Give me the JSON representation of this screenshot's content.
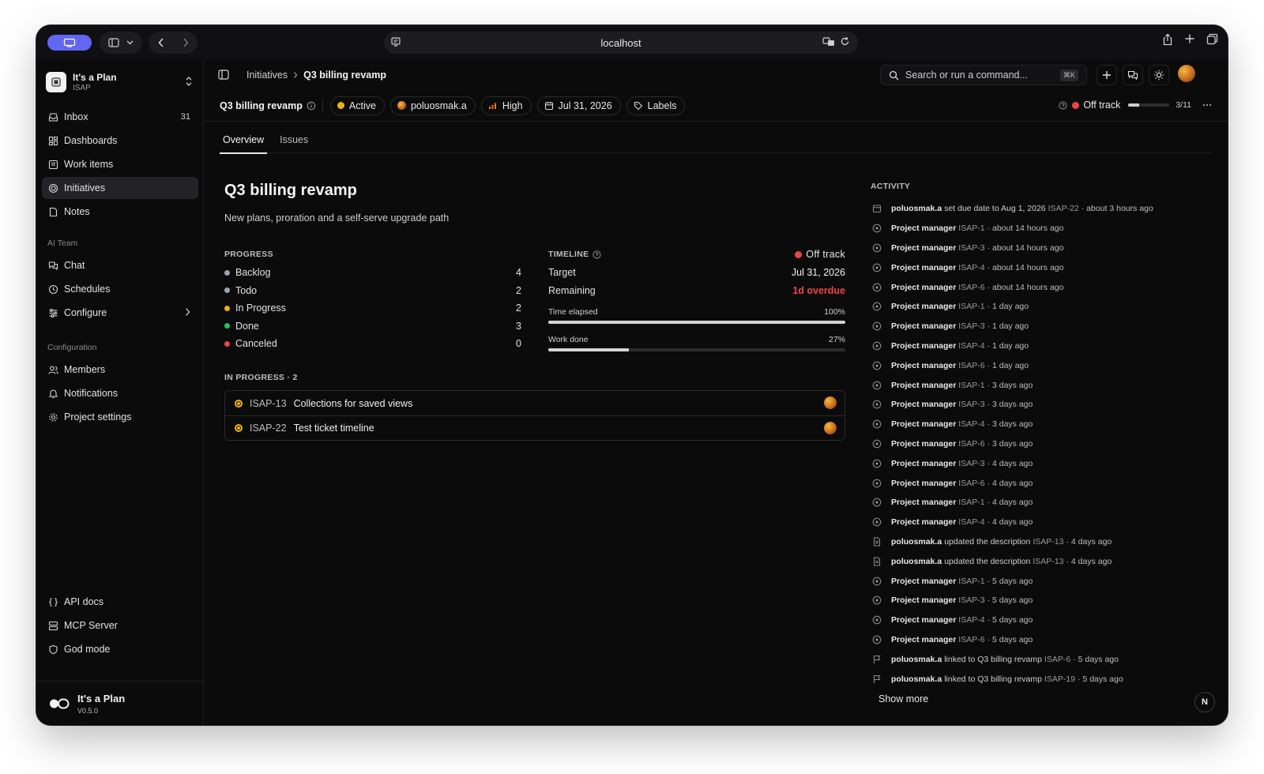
{
  "browser": {
    "url": "localhost"
  },
  "workspace": {
    "name": "It's a Plan",
    "key": "ISAP"
  },
  "sidebar": {
    "main": [
      {
        "label": "Inbox",
        "count": "31",
        "icon": "inbox-icon"
      },
      {
        "label": "Dashboards",
        "icon": "dashboard-icon"
      },
      {
        "label": "Work items",
        "icon": "work-items-icon"
      },
      {
        "label": "Initiatives",
        "icon": "initiatives-icon",
        "active": true
      },
      {
        "label": "Notes",
        "icon": "notes-icon"
      }
    ],
    "ai_section": "AI Team",
    "ai": [
      {
        "label": "Chat",
        "icon": "chat-icon"
      },
      {
        "label": "Schedules",
        "icon": "clock-icon"
      },
      {
        "label": "Configure",
        "icon": "sliders-icon"
      }
    ],
    "config_section": "Configuration",
    "config": [
      {
        "label": "Members",
        "icon": "members-icon"
      },
      {
        "label": "Notifications",
        "icon": "bell-icon"
      },
      {
        "label": "Project settings",
        "icon": "gear-icon"
      }
    ],
    "bottom": [
      {
        "label": "API docs",
        "icon": "braces-icon"
      },
      {
        "label": "MCP Server",
        "icon": "server-icon"
      },
      {
        "label": "God mode",
        "icon": "shield-icon"
      }
    ],
    "brand": {
      "name": "It's a Plan",
      "version": "V0.5.0"
    }
  },
  "topbar": {
    "breadcrumb": [
      "Initiatives",
      "Q3 billing revamp"
    ],
    "search_placeholder": "Search or run a command...",
    "search_shortcut": "⌘K"
  },
  "propbar": {
    "title": "Q3 billing revamp",
    "status": "Active",
    "owner": "poluosmak.a",
    "priority": "High",
    "due": "Jul 31, 2026",
    "labels": "Labels",
    "health": "Off track",
    "progress_fraction": 0.27,
    "progress_text": "3/11"
  },
  "tabs": [
    "Overview",
    "Issues"
  ],
  "overview": {
    "title": "Q3 billing revamp",
    "description": "New plans, proration and a self-serve upgrade path",
    "progress_label": "PROGRESS",
    "progress": [
      {
        "label": "Backlog",
        "value": "4",
        "color": "#9ca3af"
      },
      {
        "label": "Todo",
        "value": "2",
        "color": "#9ca3af"
      },
      {
        "label": "In Progress",
        "value": "2",
        "color": "#eab308"
      },
      {
        "label": "Done",
        "value": "3",
        "color": "#22c55e"
      },
      {
        "label": "Canceled",
        "value": "0",
        "color": "#ef4444"
      }
    ],
    "timeline_label": "TIMELINE",
    "timeline_status": "Off track",
    "target_label": "Target",
    "target_value": "Jul 31, 2026",
    "remaining_label": "Remaining",
    "remaining_value": "1d overdue",
    "time_elapsed_label": "Time elapsed",
    "time_elapsed_value": "100%",
    "time_elapsed_fraction": 1.0,
    "work_done_label": "Work done",
    "work_done_value": "27%",
    "work_done_fraction": 0.27,
    "in_progress_label": "IN PROGRESS · 2",
    "in_progress_items": [
      {
        "id": "ISAP-13",
        "title": "Collections for saved views"
      },
      {
        "id": "ISAP-22",
        "title": "Test ticket timeline"
      }
    ]
  },
  "activity": {
    "title": "ACTIVITY",
    "items": [
      {
        "icon": "calendar-icon",
        "who": "poluosmak.a",
        "text": "set due date to Aug 1, 2026",
        "issue": "ISAP-22",
        "time": "· about 3 hours ago"
      },
      {
        "icon": "status-icon",
        "who": "Project manager",
        "text": "",
        "issue": "ISAP-1",
        "time": "· about 14 hours ago"
      },
      {
        "icon": "status-icon",
        "who": "Project manager",
        "text": "",
        "issue": "ISAP-3",
        "time": "· about 14 hours ago"
      },
      {
        "icon": "status-icon",
        "who": "Project manager",
        "text": "",
        "issue": "ISAP-4",
        "time": "· about 14 hours ago"
      },
      {
        "icon": "status-icon",
        "who": "Project manager",
        "text": "",
        "issue": "ISAP-6",
        "time": "· about 14 hours ago"
      },
      {
        "icon": "status-icon",
        "who": "Project manager",
        "text": "",
        "issue": "ISAP-1",
        "time": "· 1 day ago"
      },
      {
        "icon": "status-icon",
        "who": "Project manager",
        "text": "",
        "issue": "ISAP-3",
        "time": "· 1 day ago"
      },
      {
        "icon": "status-icon",
        "who": "Project manager",
        "text": "",
        "issue": "ISAP-4",
        "time": "· 1 day ago"
      },
      {
        "icon": "status-icon",
        "who": "Project manager",
        "text": "",
        "issue": "ISAP-6",
        "time": "· 1 day ago"
      },
      {
        "icon": "status-icon",
        "who": "Project manager",
        "text": "",
        "issue": "ISAP-1",
        "time": "· 3 days ago"
      },
      {
        "icon": "status-icon",
        "who": "Project manager",
        "text": "",
        "issue": "ISAP-3",
        "time": "· 3 days ago"
      },
      {
        "icon": "status-icon",
        "who": "Project manager",
        "text": "",
        "issue": "ISAP-4",
        "time": "· 3 days ago"
      },
      {
        "icon": "status-icon",
        "who": "Project manager",
        "text": "",
        "issue": "ISAP-6",
        "time": "· 3 days ago"
      },
      {
        "icon": "status-icon",
        "who": "Project manager",
        "text": "",
        "issue": "ISAP-3",
        "time": "· 4 days ago"
      },
      {
        "icon": "status-icon",
        "who": "Project manager",
        "text": "",
        "issue": "ISAP-6",
        "time": "· 4 days ago"
      },
      {
        "icon": "status-icon",
        "who": "Project manager",
        "text": "",
        "issue": "ISAP-1",
        "time": "· 4 days ago"
      },
      {
        "icon": "status-icon",
        "who": "Project manager",
        "text": "",
        "issue": "ISAP-4",
        "time": "· 4 days ago"
      },
      {
        "icon": "document-icon",
        "who": "poluosmak.a",
        "text": "updated the description",
        "issue": "ISAP-13",
        "time": "· 4 days ago"
      },
      {
        "icon": "document-icon",
        "who": "poluosmak.a",
        "text": "updated the description",
        "issue": "ISAP-13",
        "time": "· 4 days ago"
      },
      {
        "icon": "status-icon",
        "who": "Project manager",
        "text": "",
        "issue": "ISAP-1",
        "time": "· 5 days ago"
      },
      {
        "icon": "status-icon",
        "who": "Project manager",
        "text": "",
        "issue": "ISAP-3",
        "time": "· 5 days ago"
      },
      {
        "icon": "status-icon",
        "who": "Project manager",
        "text": "",
        "issue": "ISAP-4",
        "time": "· 5 days ago"
      },
      {
        "icon": "status-icon",
        "who": "Project manager",
        "text": "",
        "issue": "ISAP-6",
        "time": "· 5 days ago"
      },
      {
        "icon": "flag-icon",
        "who": "poluosmak.a",
        "text": "linked to Q3 billing revamp",
        "issue": "ISAP-6",
        "time": "· 5 days ago"
      },
      {
        "icon": "flag-icon",
        "who": "poluosmak.a",
        "text": "linked to Q3 billing revamp",
        "issue": "ISAP-19",
        "time": "· 5 days ago"
      }
    ],
    "show_more": "Show more"
  },
  "floating_badge": "N",
  "colors": {
    "accent": "#6366f1",
    "danger": "#ef4444",
    "warning": "#eab308",
    "success": "#22c55e"
  }
}
